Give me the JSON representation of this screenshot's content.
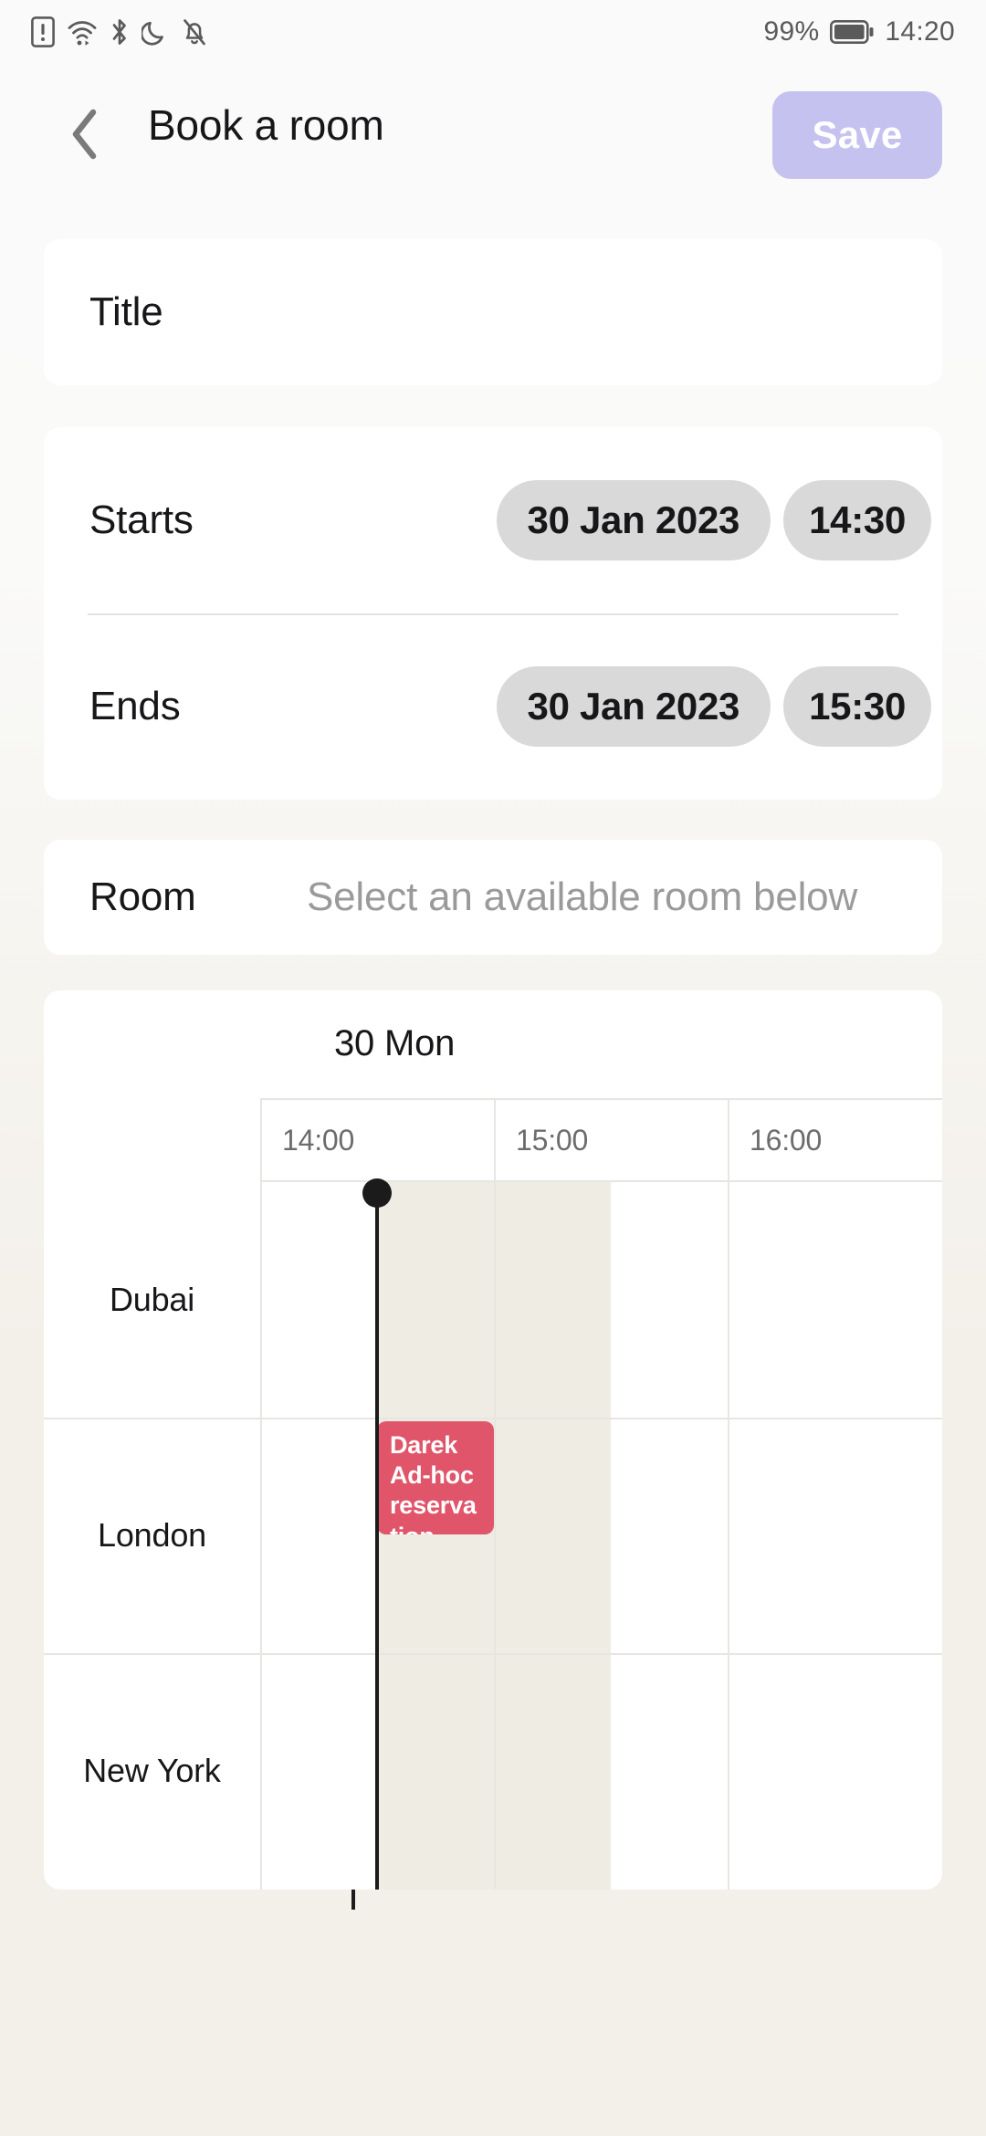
{
  "status_bar": {
    "icons": [
      "sim-alert-icon",
      "wifi-icon",
      "bluetooth-icon",
      "do-not-disturb-moon-icon",
      "bell-muted-icon"
    ],
    "battery_percent": "99%",
    "battery_icon": "battery-full-icon",
    "clock": "14:20"
  },
  "header": {
    "back_icon": "chevron-left-icon",
    "title": "Book a room",
    "save_label": "Save",
    "save_color": "#c5c2f0"
  },
  "form": {
    "title_field": {
      "value": "",
      "placeholder": "Title"
    },
    "starts": {
      "label": "Starts",
      "date": "30 Jan 2023",
      "time": "14:30"
    },
    "ends": {
      "label": "Ends",
      "date": "30 Jan 2023",
      "time": "15:30"
    },
    "room": {
      "label": "Room",
      "placeholder": "Select an available room below"
    }
  },
  "calendar": {
    "day_label": "30 Mon",
    "time_headers": [
      "14:00",
      "15:00",
      "16:00"
    ],
    "rooms": [
      "Dubai",
      "London",
      "New York"
    ],
    "events": [
      {
        "room": "London",
        "text": "Darek Ad-hoc reservation",
        "color": "#e0556a",
        "start": "14:30",
        "end": "15:00"
      }
    ],
    "selection": {
      "start": "14:30",
      "end": "15:30",
      "color": "#efece4"
    },
    "now_marker": {
      "time": "14:30",
      "color": "#1b1b1b"
    }
  }
}
